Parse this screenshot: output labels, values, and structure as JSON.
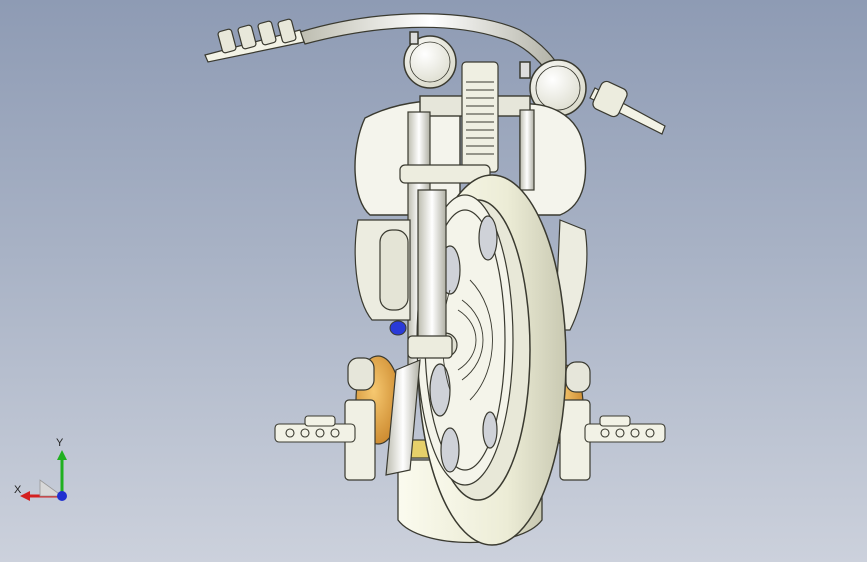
{
  "viewport": {
    "background_top": "#8e9bb4",
    "background_bottom": "#ccd1dc"
  },
  "model": {
    "part_fill": "#f2f2e4",
    "part_stroke": "#3a3a30",
    "tire_fill": "#ededd8",
    "accent_orange": "#e8a640",
    "accent_blue": "#2a3ad8"
  },
  "triad": {
    "x_label": "X",
    "y_label": "Y",
    "x_color": "#d42020",
    "y_color": "#20b020",
    "z_color": "#2030d0"
  }
}
